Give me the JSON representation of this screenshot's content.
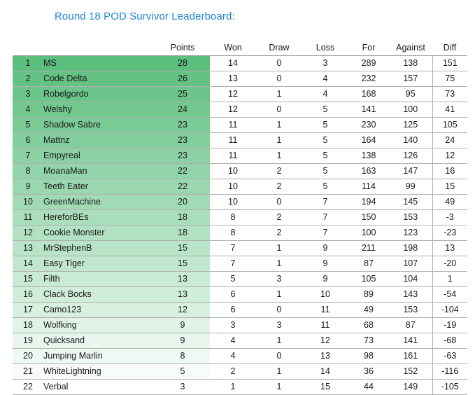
{
  "page": {
    "title": "Round 18 POD Survivor Leaderboard:",
    "title_color": "#2086d8",
    "background": "#ffffff"
  },
  "table": {
    "headers": {
      "rank": "",
      "name": "",
      "points": "Points",
      "won": "Won",
      "draw": "Draw",
      "loss": "Loss",
      "for": "For",
      "against": "Against",
      "diff": "Diff"
    },
    "highlight": {
      "top_color": "#5cbf7e",
      "fade_to_color": "#ffffff",
      "shaded_columns": [
        "rank",
        "name",
        "points"
      ],
      "shaded_row_count": 22
    },
    "rows": [
      {
        "rank": "1",
        "name": "MS",
        "points": "28",
        "won": "14",
        "draw": "0",
        "loss": "3",
        "for": "289",
        "against": "138",
        "diff": "151"
      },
      {
        "rank": "2",
        "name": "Code Delta",
        "points": "26",
        "won": "13",
        "draw": "0",
        "loss": "4",
        "for": "232",
        "against": "157",
        "diff": "75"
      },
      {
        "rank": "3",
        "name": "Robelgordo",
        "points": "25",
        "won": "12",
        "draw": "1",
        "loss": "4",
        "for": "168",
        "against": "95",
        "diff": "73"
      },
      {
        "rank": "4",
        "name": "Welshy",
        "points": "24",
        "won": "12",
        "draw": "0",
        "loss": "5",
        "for": "141",
        "against": "100",
        "diff": "41"
      },
      {
        "rank": "5",
        "name": "Shadow Sabre",
        "points": "23",
        "won": "11",
        "draw": "1",
        "loss": "5",
        "for": "230",
        "against": "125",
        "diff": "105"
      },
      {
        "rank": "6",
        "name": "Mattnz",
        "points": "23",
        "won": "11",
        "draw": "1",
        "loss": "5",
        "for": "164",
        "against": "140",
        "diff": "24"
      },
      {
        "rank": "7",
        "name": "Empyreal",
        "points": "23",
        "won": "11",
        "draw": "1",
        "loss": "5",
        "for": "138",
        "against": "126",
        "diff": "12"
      },
      {
        "rank": "8",
        "name": "MoanaMan",
        "points": "22",
        "won": "10",
        "draw": "2",
        "loss": "5",
        "for": "163",
        "against": "147",
        "diff": "16"
      },
      {
        "rank": "9",
        "name": "Teeth Eater",
        "points": "22",
        "won": "10",
        "draw": "2",
        "loss": "5",
        "for": "114",
        "against": "99",
        "diff": "15"
      },
      {
        "rank": "10",
        "name": "GreenMachine",
        "points": "20",
        "won": "10",
        "draw": "0",
        "loss": "7",
        "for": "194",
        "against": "145",
        "diff": "49"
      },
      {
        "rank": "11",
        "name": "HereforBEs",
        "points": "18",
        "won": "8",
        "draw": "2",
        "loss": "7",
        "for": "150",
        "against": "153",
        "diff": "-3"
      },
      {
        "rank": "12",
        "name": "Cookie Monster",
        "points": "18",
        "won": "8",
        "draw": "2",
        "loss": "7",
        "for": "100",
        "against": "123",
        "diff": "-23"
      },
      {
        "rank": "13",
        "name": "MrStephenB",
        "points": "15",
        "won": "7",
        "draw": "1",
        "loss": "9",
        "for": "211",
        "against": "198",
        "diff": "13"
      },
      {
        "rank": "14",
        "name": "Easy Tiger",
        "points": "15",
        "won": "7",
        "draw": "1",
        "loss": "9",
        "for": "87",
        "against": "107",
        "diff": "-20"
      },
      {
        "rank": "15",
        "name": "Filth",
        "points": "13",
        "won": "5",
        "draw": "3",
        "loss": "9",
        "for": "105",
        "against": "104",
        "diff": "1"
      },
      {
        "rank": "16",
        "name": "Clack Bocks",
        "points": "13",
        "won": "6",
        "draw": "1",
        "loss": "10",
        "for": "89",
        "against": "143",
        "diff": "-54"
      },
      {
        "rank": "17",
        "name": "Camo123",
        "points": "12",
        "won": "6",
        "draw": "0",
        "loss": "11",
        "for": "49",
        "against": "153",
        "diff": "-104"
      },
      {
        "rank": "18",
        "name": "Wolfking",
        "points": "9",
        "won": "3",
        "draw": "3",
        "loss": "11",
        "for": "68",
        "against": "87",
        "diff": "-19"
      },
      {
        "rank": "19",
        "name": "Quicksand",
        "points": "9",
        "won": "4",
        "draw": "1",
        "loss": "12",
        "for": "73",
        "against": "141",
        "diff": "-68"
      },
      {
        "rank": "20",
        "name": "Jumping Marlin",
        "points": "8",
        "won": "4",
        "draw": "0",
        "loss": "13",
        "for": "98",
        "against": "161",
        "diff": "-63"
      },
      {
        "rank": "21",
        "name": "WhiteLightning",
        "points": "5",
        "won": "2",
        "draw": "1",
        "loss": "14",
        "for": "36",
        "against": "152",
        "diff": "-116"
      },
      {
        "rank": "22",
        "name": "Verbal",
        "points": "3",
        "won": "1",
        "draw": "1",
        "loss": "15",
        "for": "44",
        "against": "149",
        "diff": "-105"
      }
    ]
  }
}
